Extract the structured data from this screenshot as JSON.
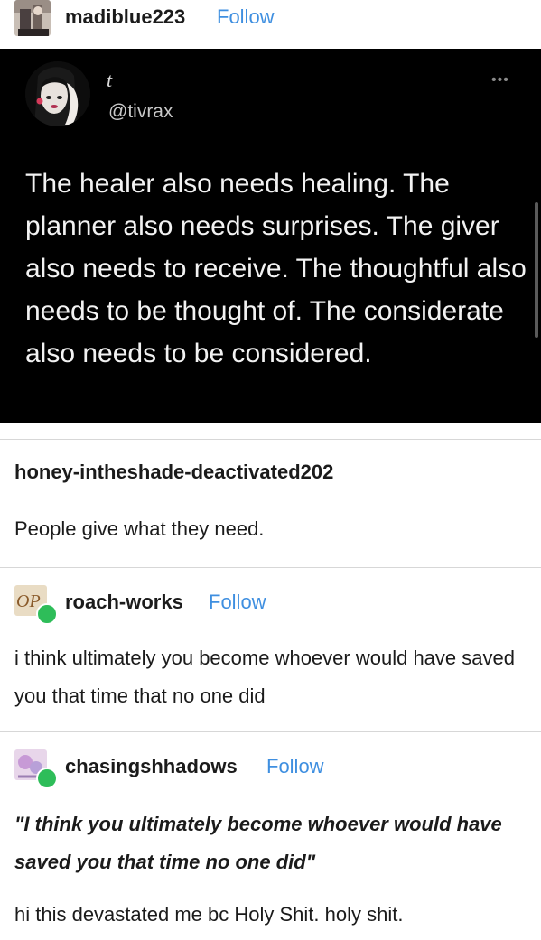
{
  "post": {
    "author": "madiblue223",
    "follow_label": "Follow"
  },
  "tweet": {
    "name": "t",
    "handle": "@tivrax",
    "more": "•••",
    "text": "The healer also needs healing. The planner also needs surprises. The giver also needs to receive. The thoughtful also needs to be thought of. The considerate also needs to be considered."
  },
  "reblogs": [
    {
      "user": "honey-intheshade-deactivated202",
      "text": "People give what they need."
    },
    {
      "user": "roach-works",
      "follow_label": "Follow",
      "text": "i think ultimately you become whoever would have saved you that time that no one did"
    },
    {
      "user": "chasingshhadows",
      "follow_label": "Follow",
      "quote": "\"I think you ultimately become whoever would have saved you that time no one did\"",
      "text": "hi this devastated me bc Holy Shit. holy shit."
    }
  ]
}
